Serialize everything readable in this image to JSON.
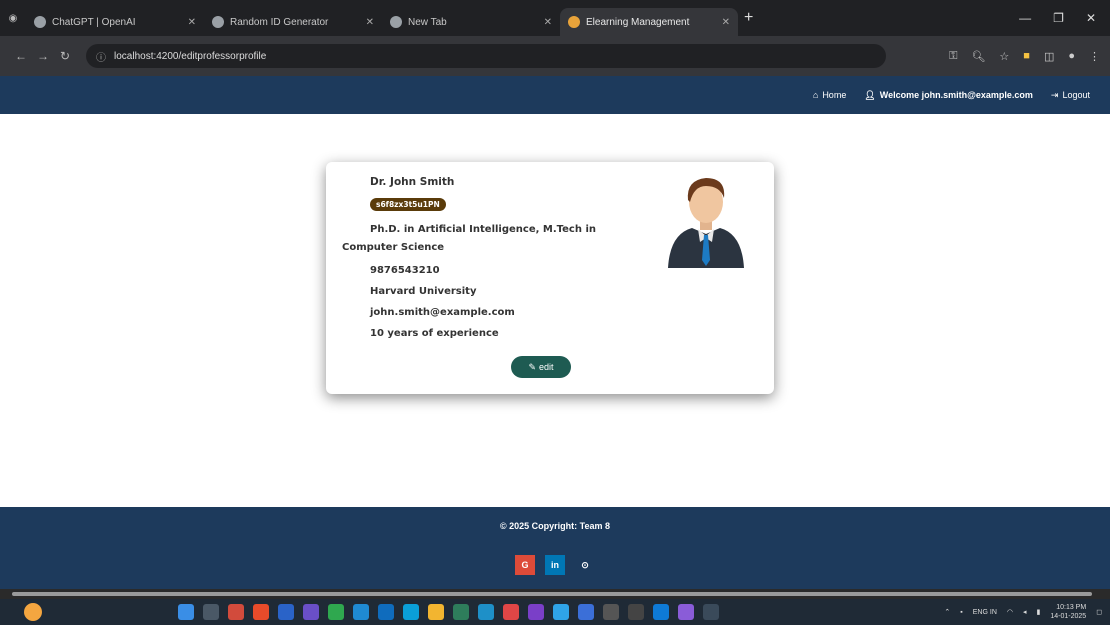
{
  "browser": {
    "tabs": [
      {
        "title": "ChatGPT | OpenAI",
        "active": false
      },
      {
        "title": "Random ID Generator",
        "active": false
      },
      {
        "title": "New Tab",
        "active": false
      },
      {
        "title": "Elearning Management",
        "active": true
      }
    ],
    "address": "localhost:4200/editprofessorprofile"
  },
  "navbar": {
    "home": "Home",
    "welcome": "Welcome john.smith@example.com",
    "logout": "Logout"
  },
  "profile": {
    "name": "Dr. John Smith",
    "id_badge": "s6f8zx3t5u1PN",
    "qualification": "Ph.D. in Artificial Intelligence, M.Tech in Computer Science",
    "phone": "9876543210",
    "university": "Harvard University",
    "email": "john.smith@example.com",
    "experience": "10 years of experience",
    "edit_label": "edit"
  },
  "footer": {
    "copyright": "© 2025 Copyright: Team 8",
    "socials": [
      {
        "label": "G",
        "name": "google"
      },
      {
        "label": "in",
        "name": "linkedin"
      },
      {
        "label": "⊙",
        "name": "github"
      }
    ]
  },
  "taskbar": {
    "lang": "ENG IN",
    "time": "10:13 PM",
    "date": "14-01-2025"
  },
  "colors": {
    "navbar_bg": "#1d3a5c",
    "badge_bg": "#5a3b0a",
    "edit_btn": "#1e5b52"
  }
}
